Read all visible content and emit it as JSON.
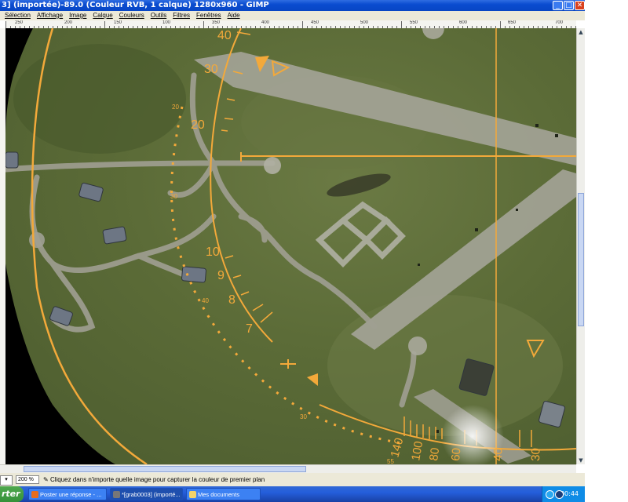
{
  "window": {
    "title": "3] (importée)-89.0 (Couleur RVB, 1 calque) 1280x960 - GIMP",
    "buttons": {
      "minimize": "_",
      "maximize": "□",
      "close": "✕"
    }
  },
  "menu": {
    "items": [
      "Sélection",
      "Affichage",
      "Image",
      "Calque",
      "Couleurs",
      "Outils",
      "Filtres",
      "Fenêtres",
      "Aide"
    ]
  },
  "ruler": {
    "labels": [
      "250",
      "200",
      "150",
      "100",
      "50",
      "0",
      "350",
      "400",
      "450",
      "500",
      "550",
      "600",
      "650",
      "700"
    ]
  },
  "hud": {
    "scale_upper": [
      "40",
      "30",
      "20"
    ],
    "scale_lower": [
      "10",
      "9",
      "8",
      "7"
    ],
    "small_marks": [
      "20",
      "30",
      "40",
      "30",
      "55"
    ],
    "speed_labels": [
      "140",
      "100",
      "80",
      "60",
      "40",
      "30"
    ],
    "colors": {
      "hud": "#f3a93a",
      "grass": "#5d6d37",
      "runway": "#9a9a8a"
    }
  },
  "statusbar": {
    "unit": " ",
    "zoom": "200 %",
    "message": "Cliquez dans n'importe quelle image pour capturer la couleur de premier plan"
  },
  "taskbar": {
    "start_label": "rter",
    "tasks": [
      {
        "label": "Poster une réponse - ...",
        "icon": "firefox-icon"
      },
      {
        "label": "*[grab0003] (importé...",
        "icon": "gimp-icon"
      },
      {
        "label": "Mes documents",
        "icon": "folder-icon"
      }
    ],
    "clock": "00:44"
  }
}
